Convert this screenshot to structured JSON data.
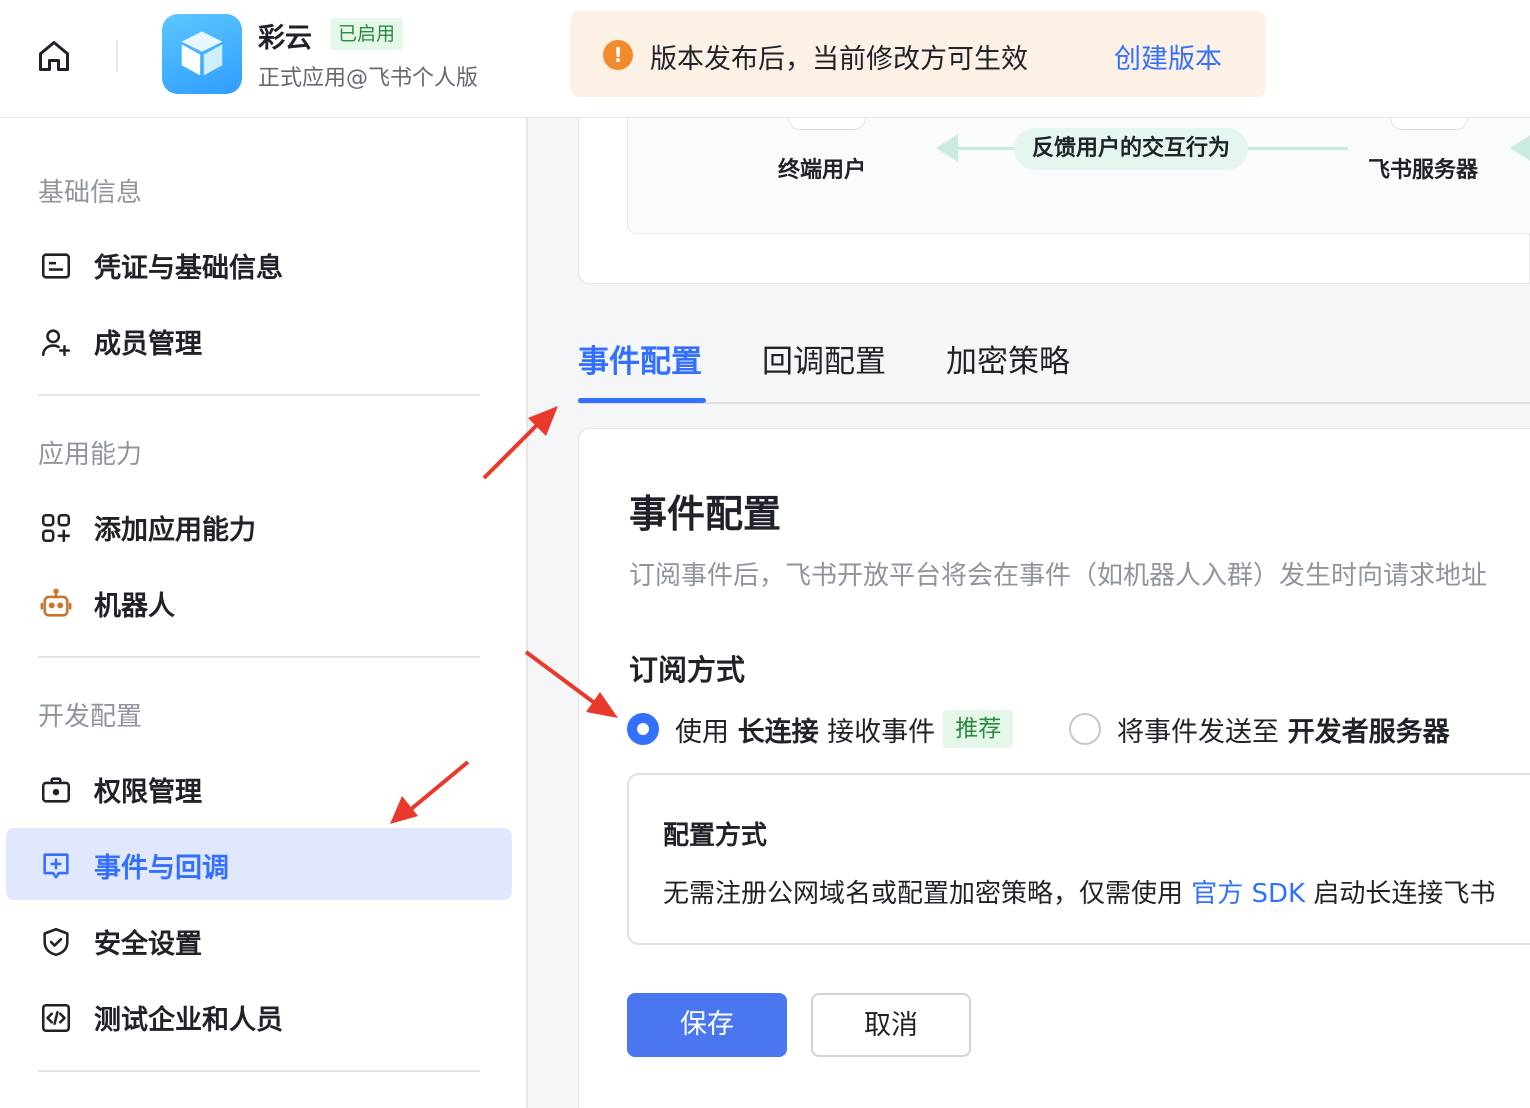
{
  "header": {
    "app_name": "彩云",
    "status_badge": "已启用",
    "app_subtitle": "正式应用@飞书个人版",
    "notice_text": "版本发布后，当前修改方可生效",
    "notice_link": "创建版本"
  },
  "sidebar": {
    "sections": [
      {
        "title": "基础信息",
        "items": [
          {
            "label": "凭证与基础信息",
            "icon": "id-card-icon"
          },
          {
            "label": "成员管理",
            "icon": "user-add-icon"
          }
        ]
      },
      {
        "title": "应用能力",
        "items": [
          {
            "label": "添加应用能力",
            "icon": "apps-add-icon"
          },
          {
            "label": "机器人",
            "icon": "robot-icon"
          }
        ]
      },
      {
        "title": "开发配置",
        "items": [
          {
            "label": "权限管理",
            "icon": "briefcase-lock-icon"
          },
          {
            "label": "事件与回调",
            "icon": "event-add-icon",
            "active": true
          },
          {
            "label": "安全设置",
            "icon": "shield-check-icon"
          },
          {
            "label": "测试企业和人员",
            "icon": "code-icon"
          }
        ]
      }
    ]
  },
  "flow": {
    "left_node": "终端用户",
    "edge_label": "反馈用户的交互行为",
    "right_node": "飞书服务器"
  },
  "tabs": [
    {
      "label": "事件配置",
      "active": true
    },
    {
      "label": "回调配置"
    },
    {
      "label": "加密策略"
    }
  ],
  "config": {
    "title": "事件配置",
    "description": "订阅事件后，飞书开放平台将会在事件（如机器人入群）发生时向请求地址",
    "subscription_title": "订阅方式",
    "option_long_conn": {
      "prefix": "使用 ",
      "bold": "长连接",
      "suffix": " 接收事件",
      "badge": "推荐",
      "checked": true
    },
    "option_server": {
      "prefix": "将事件发送至 ",
      "bold": "开发者服务器",
      "checked": false
    },
    "method_title": "配置方式",
    "method_text_prefix": "无需注册公网域名或配置加密策略，仅需使用 ",
    "method_link": "官方 SDK",
    "method_text_suffix": " 启动长连接飞书",
    "save_label": "保存",
    "cancel_label": "取消"
  },
  "colors": {
    "accent": "#3370ff",
    "active_bg": "#e1e8fd",
    "notice_bg": "#fdf0e5",
    "notice_icon": "#f28b2c",
    "badge_bg": "#e4f7e8",
    "badge_text": "#2a8a3e",
    "annotation_arrow": "#e8392a"
  }
}
